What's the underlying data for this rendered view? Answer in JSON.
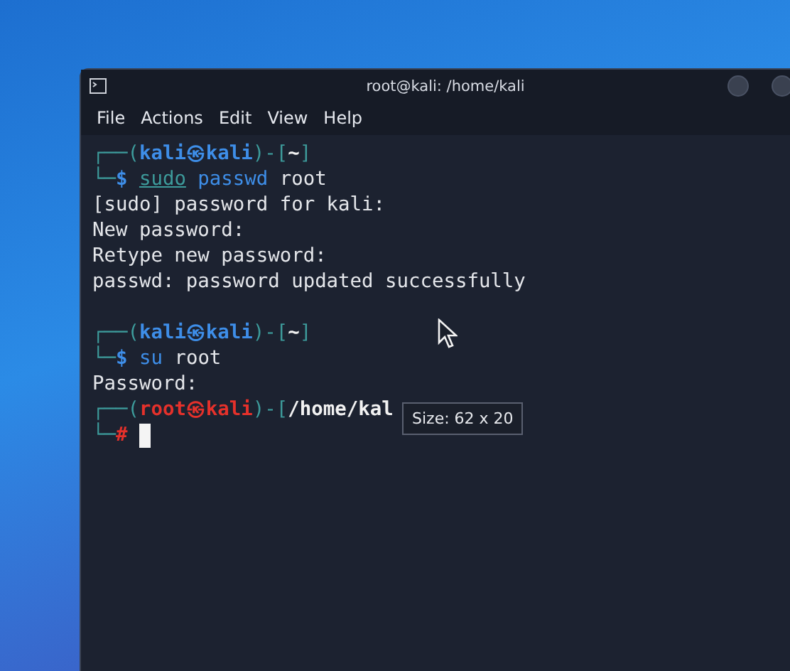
{
  "window": {
    "title": "root@kali: /home/kali"
  },
  "menu": [
    "File",
    "Actions",
    "Edit",
    "View",
    "Help"
  ],
  "lines": [
    {
      "kind": "prompt",
      "segments": [
        {
          "text": "┌──(",
          "kind": "frame"
        },
        {
          "text": "kali㉿kali",
          "kind": "user"
        },
        {
          "text": ")-[",
          "kind": "frame"
        },
        {
          "text": "~",
          "kind": "path"
        },
        {
          "text": "]",
          "kind": "frame"
        }
      ]
    },
    {
      "kind": "command",
      "segments": [
        {
          "text": "└─",
          "kind": "frame"
        },
        {
          "text": "$ ",
          "kind": "user"
        },
        {
          "text": "sudo",
          "kind": "suggest"
        },
        {
          "text": " passwd",
          "kind": "program"
        },
        {
          "text": " root",
          "kind": "plain"
        }
      ]
    },
    {
      "kind": "output",
      "text": "[sudo] password for kali:"
    },
    {
      "kind": "output",
      "text": "New password:"
    },
    {
      "kind": "output",
      "text": "Retype new password:"
    },
    {
      "kind": "output",
      "text": "passwd: password updated successfully"
    },
    {
      "kind": "blank"
    },
    {
      "kind": "prompt",
      "segments": [
        {
          "text": "┌──(",
          "kind": "frame"
        },
        {
          "text": "kali㉿kali",
          "kind": "user"
        },
        {
          "text": ")-[",
          "kind": "frame"
        },
        {
          "text": "~",
          "kind": "path"
        },
        {
          "text": "]",
          "kind": "frame"
        }
      ]
    },
    {
      "kind": "command",
      "segments": [
        {
          "text": "└─",
          "kind": "frame"
        },
        {
          "text": "$",
          "kind": "user"
        },
        {
          "text": " su",
          "kind": "program"
        },
        {
          "text": " root",
          "kind": "plain"
        }
      ]
    },
    {
      "kind": "output",
      "text": "Password:"
    },
    {
      "kind": "prompt",
      "segments": [
        {
          "text": "┌──(",
          "kind": "frame"
        },
        {
          "text": "root㉿kali",
          "kind": "root"
        },
        {
          "text": ")-[",
          "kind": "frame"
        },
        {
          "text": "/home/kal",
          "kind": "path"
        }
      ]
    },
    {
      "kind": "command",
      "cursor": true,
      "segments": [
        {
          "text": "└─",
          "kind": "frame"
        },
        {
          "text": "#",
          "kind": "root"
        }
      ]
    }
  ],
  "tooltip": "Size: 62 x 20"
}
